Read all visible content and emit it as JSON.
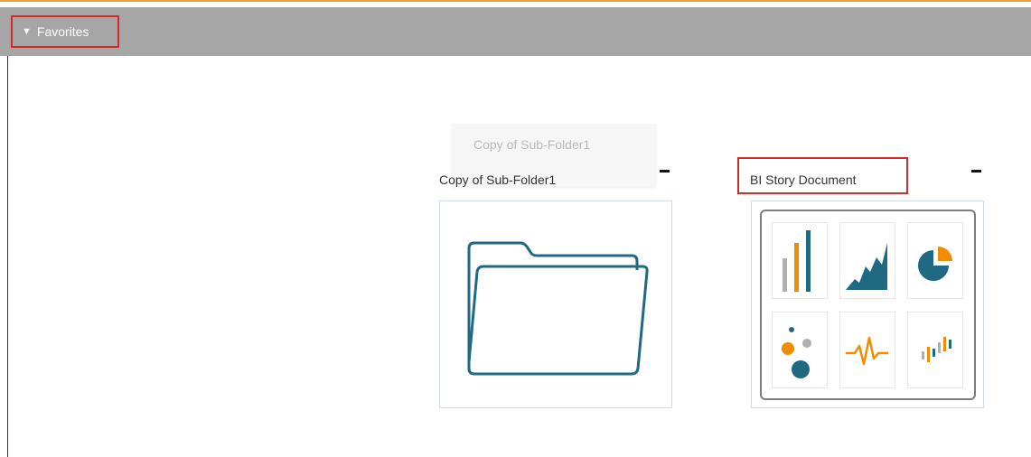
{
  "favorites": {
    "label": "Favorites"
  },
  "ghost": {
    "label": "Copy of Sub-Folder1"
  },
  "items": [
    {
      "title": "Copy of Sub-Folder1",
      "icon": "folder-icon"
    },
    {
      "title": "BI Story Document",
      "icon": "bi-story-document-icon"
    }
  ],
  "colors": {
    "accent_line": "#f0a030",
    "favorites_bar": "#a6a6a6",
    "highlight": "#d42a2a",
    "teal": "#1f6a82",
    "orange": "#f08c00",
    "gray": "#b0b0b0"
  }
}
